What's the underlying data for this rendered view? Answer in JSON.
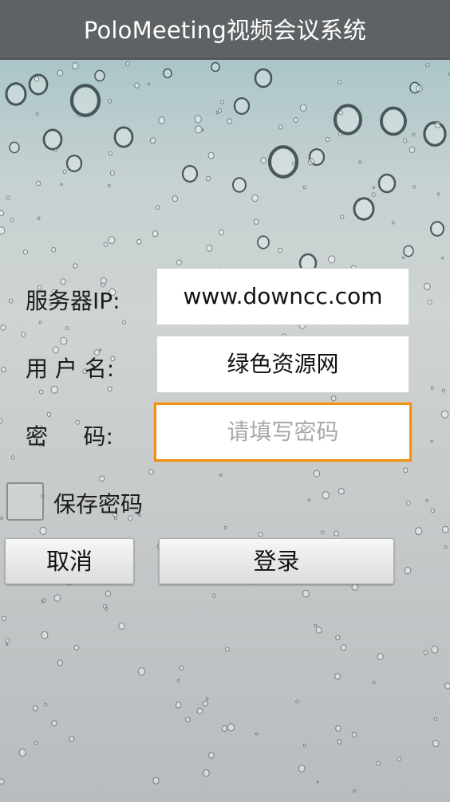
{
  "title": "PoloMeeting视频会议系统",
  "form": {
    "server": {
      "label": "服务器IP:",
      "value": "www.downcc.com"
    },
    "user": {
      "label": "用 户 名:",
      "value": "绿色资源网"
    },
    "password": {
      "label": "密     码:",
      "placeholder": "请填写密码"
    },
    "remember": {
      "label": "保存密码",
      "checked": false
    }
  },
  "buttons": {
    "cancel": "取消",
    "login": "登录"
  },
  "colors": {
    "titlebar": "#5f6264",
    "focus_border": "#f09117"
  }
}
